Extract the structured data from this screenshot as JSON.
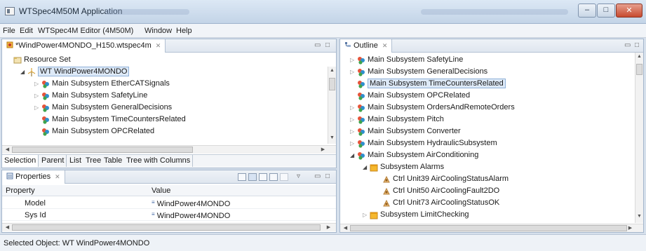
{
  "window": {
    "title": "WTSpec4M50M Application",
    "min_label": "–",
    "max_label": "□",
    "close_label": "✕"
  },
  "menu": [
    "File",
    "Edit",
    "WTSpec4M Editor (4M50M)",
    "Window",
    "Help"
  ],
  "editor": {
    "tab_label": "*WindPower4MONDO_H150.wtspec4m",
    "tab_close": "✕",
    "tree": [
      {
        "label": "Resource Set",
        "depth": 0,
        "arrow": "",
        "icon": "resource-set-icon"
      },
      {
        "label": "WT WindPower4MONDO",
        "depth": 1,
        "arrow": "◢",
        "icon": "wind-turbine-icon",
        "selected": true
      },
      {
        "label": "Main Subsystem EtherCATSignals",
        "depth": 2,
        "arrow": "▷",
        "icon": "subsystem-icon"
      },
      {
        "label": "Main Subsystem SafetyLine",
        "depth": 2,
        "arrow": "▷",
        "icon": "subsystem-icon"
      },
      {
        "label": "Main Subsystem GeneralDecisions",
        "depth": 2,
        "arrow": "▷",
        "icon": "subsystem-icon"
      },
      {
        "label": "Main Subsystem TimeCountersRelated",
        "depth": 2,
        "arrow": "",
        "icon": "subsystem-icon"
      },
      {
        "label": "Main Subsystem OPCRelated",
        "depth": 2,
        "arrow": "",
        "icon": "subsystem-icon"
      }
    ],
    "bottom_tabs": [
      "Selection",
      "Parent",
      "List",
      "Tree",
      "Table",
      "Tree with Columns"
    ]
  },
  "properties": {
    "tab_label": "Properties",
    "tab_close": "✕",
    "headers": [
      "Property",
      "Value"
    ],
    "rows": [
      {
        "property": "Model",
        "value": "WindPower4MONDO"
      },
      {
        "property": "Sys Id",
        "value": "WindPower4MONDO"
      }
    ]
  },
  "outline": {
    "tab_label": "Outline",
    "tab_close": "✕",
    "tree": [
      {
        "label": "Main Subsystem SafetyLine",
        "depth": 0,
        "arrow": "▷",
        "icon": "subsystem-icon"
      },
      {
        "label": "Main Subsystem GeneralDecisions",
        "depth": 0,
        "arrow": "▷",
        "icon": "subsystem-icon"
      },
      {
        "label": "Main Subsystem TimeCountersRelated",
        "depth": 0,
        "arrow": "",
        "icon": "subsystem-icon",
        "selected": true
      },
      {
        "label": "Main Subsystem OPCRelated",
        "depth": 0,
        "arrow": "",
        "icon": "subsystem-icon"
      },
      {
        "label": "Main Subsystem OrdersAndRemoteOrders",
        "depth": 0,
        "arrow": "▷",
        "icon": "subsystem-icon"
      },
      {
        "label": "Main Subsystem Pitch",
        "depth": 0,
        "arrow": "▷",
        "icon": "subsystem-icon"
      },
      {
        "label": "Main Subsystem Converter",
        "depth": 0,
        "arrow": "▷",
        "icon": "subsystem-icon"
      },
      {
        "label": "Main Subsystem HydraulicSubsystem",
        "depth": 0,
        "arrow": "▷",
        "icon": "subsystem-icon"
      },
      {
        "label": "Main Subsystem AirConditioning",
        "depth": 0,
        "arrow": "◢",
        "icon": "subsystem-icon"
      },
      {
        "label": "Subsystem Alarms",
        "depth": 1,
        "arrow": "◢",
        "icon": "folder-icon"
      },
      {
        "label": "Ctrl Unit39 AirCoolingStatusAlarm",
        "depth": 2,
        "arrow": "",
        "icon": "ctrl-unit-icon"
      },
      {
        "label": "Ctrl Unit50 AirCoolingFault2DO",
        "depth": 2,
        "arrow": "",
        "icon": "ctrl-unit-icon"
      },
      {
        "label": "Ctrl Unit73 AirCoolingStatusOK",
        "depth": 2,
        "arrow": "",
        "icon": "ctrl-unit-icon"
      },
      {
        "label": "Subsystem LimitChecking",
        "depth": 1,
        "arrow": "▷",
        "icon": "folder-icon"
      }
    ]
  },
  "status": {
    "text": "Selected Object: WT WindPower4MONDO"
  },
  "colors": {
    "selection": "#dde9f7",
    "frame": "#a6b7cc"
  }
}
